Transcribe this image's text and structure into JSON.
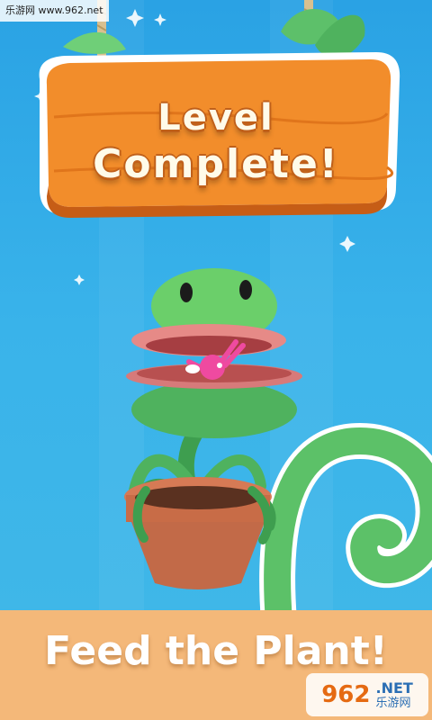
{
  "watermark_top": "乐游网 www.962.net",
  "title": {
    "line1": "Level",
    "line2": "Complete!"
  },
  "caption": "Feed the Plant!",
  "badge": {
    "number": "962",
    "net": ".NET",
    "cn": "乐游网"
  },
  "colors": {
    "sky": "#39b3ea",
    "sign": "#f28d2b",
    "plant_green": "#62c46b",
    "pot": "#c26a48",
    "caption_bar": "#f4b879"
  }
}
